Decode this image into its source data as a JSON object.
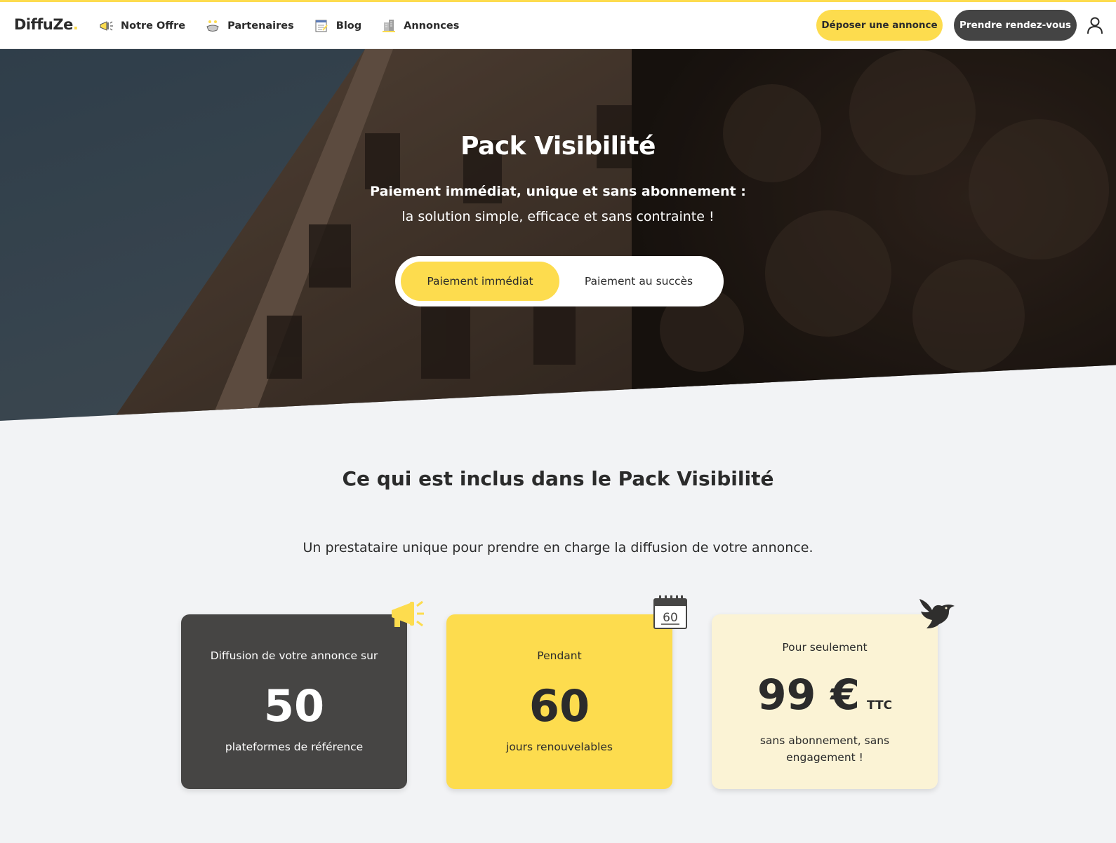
{
  "nav": {
    "logo": "DiffuZe",
    "logo_dot": ".",
    "links": [
      {
        "label": "Notre Offre",
        "icon": "megaphone-icon"
      },
      {
        "label": "Partenaires",
        "icon": "handshake-icon"
      },
      {
        "label": "Blog",
        "icon": "notepad-icon"
      },
      {
        "label": "Annonces",
        "icon": "buildings-icon"
      }
    ],
    "deposit_button": "Déposer une annonce",
    "appointment_button": "Prendre rendez-vous",
    "user_icon": "user-icon"
  },
  "hero": {
    "title": "Pack Visibilité",
    "subtitle_bold": "Paiement immédiat, unique et sans abonnement :",
    "subtitle": "la solution simple, efficace et sans contrainte !",
    "toggle": {
      "option_1": "Paiement immédiat",
      "option_2": "Paiement au succès",
      "selected": "Paiement immédiat"
    }
  },
  "section": {
    "title": "Ce qui est inclus dans le Pack Visibilité",
    "subtitle": "Un prestataire unique pour prendre en charge la diffusion de votre annonce."
  },
  "cards": [
    {
      "top": "Diffusion de votre annonce sur",
      "value": "50",
      "bottom": "plateformes de référence",
      "icon": "megaphone-icon"
    },
    {
      "top": "Pendant",
      "value": "60",
      "bottom": "jours renouvelables",
      "icon": "calendar-icon",
      "icon_text": "60"
    },
    {
      "top": "Pour seulement",
      "value": "99 €",
      "unit": "TTC",
      "bottom": "sans abonnement, sans engagement !",
      "icon": "dove-icon"
    }
  ],
  "colors": {
    "brand_yellow": "#fddc4e",
    "dark": "#464544",
    "cream": "#fbf3d5",
    "background": "#f2f3f5"
  }
}
